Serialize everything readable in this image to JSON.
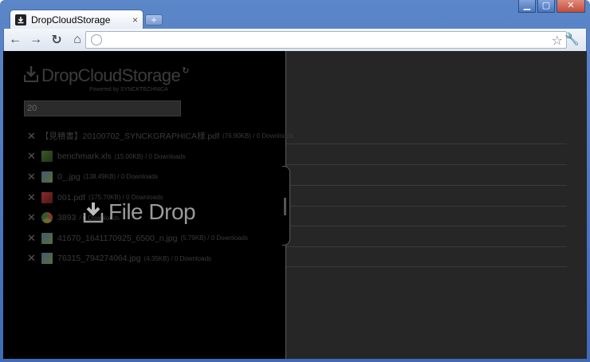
{
  "window": {
    "minimize": "▁",
    "maximize": "▢",
    "close": "✕"
  },
  "tab": {
    "title": "DropCloudStorage",
    "close": "×",
    "new_tab": "+"
  },
  "toolbar": {
    "back": "←",
    "forward": "→",
    "reload": "↻",
    "home": "⌂",
    "address_value": "",
    "bookmark": "☆",
    "settings": "🔧"
  },
  "app": {
    "logo_text": "DropCloudStorage",
    "logo_refresh": "↻",
    "powered_by": "Powered by SYNCKTECHNICA",
    "search_value": "20",
    "file_drop_label": "File Drop",
    "files": [
      {
        "name": "【見積書】20100702_SYNCKGRAPHICA様.pdf",
        "meta": "(76.90KB) / 0 Downloads",
        "type": "pdf"
      },
      {
        "name": "benchmark.xls",
        "meta": "(15.00KB) / 0 Downloads",
        "type": "xls"
      },
      {
        "name": "0_.jpg",
        "meta": "(138.49KB) / 0 Downloads",
        "type": "img"
      },
      {
        "name": "001.pdf",
        "meta": "(175.70KB) / 0 Downloads",
        "type": "pdf"
      },
      {
        "name": "3893",
        "meta": "/ 0 Downloads",
        "type": "chrome"
      },
      {
        "name": "41670_1641170925_6500_n.jpg",
        "meta": "(5.79KB) / 0 Downloads",
        "type": "img"
      },
      {
        "name": "76315_794274064.jpg",
        "meta": "(4.35KB) / 0 Downloads",
        "type": "img"
      }
    ]
  }
}
